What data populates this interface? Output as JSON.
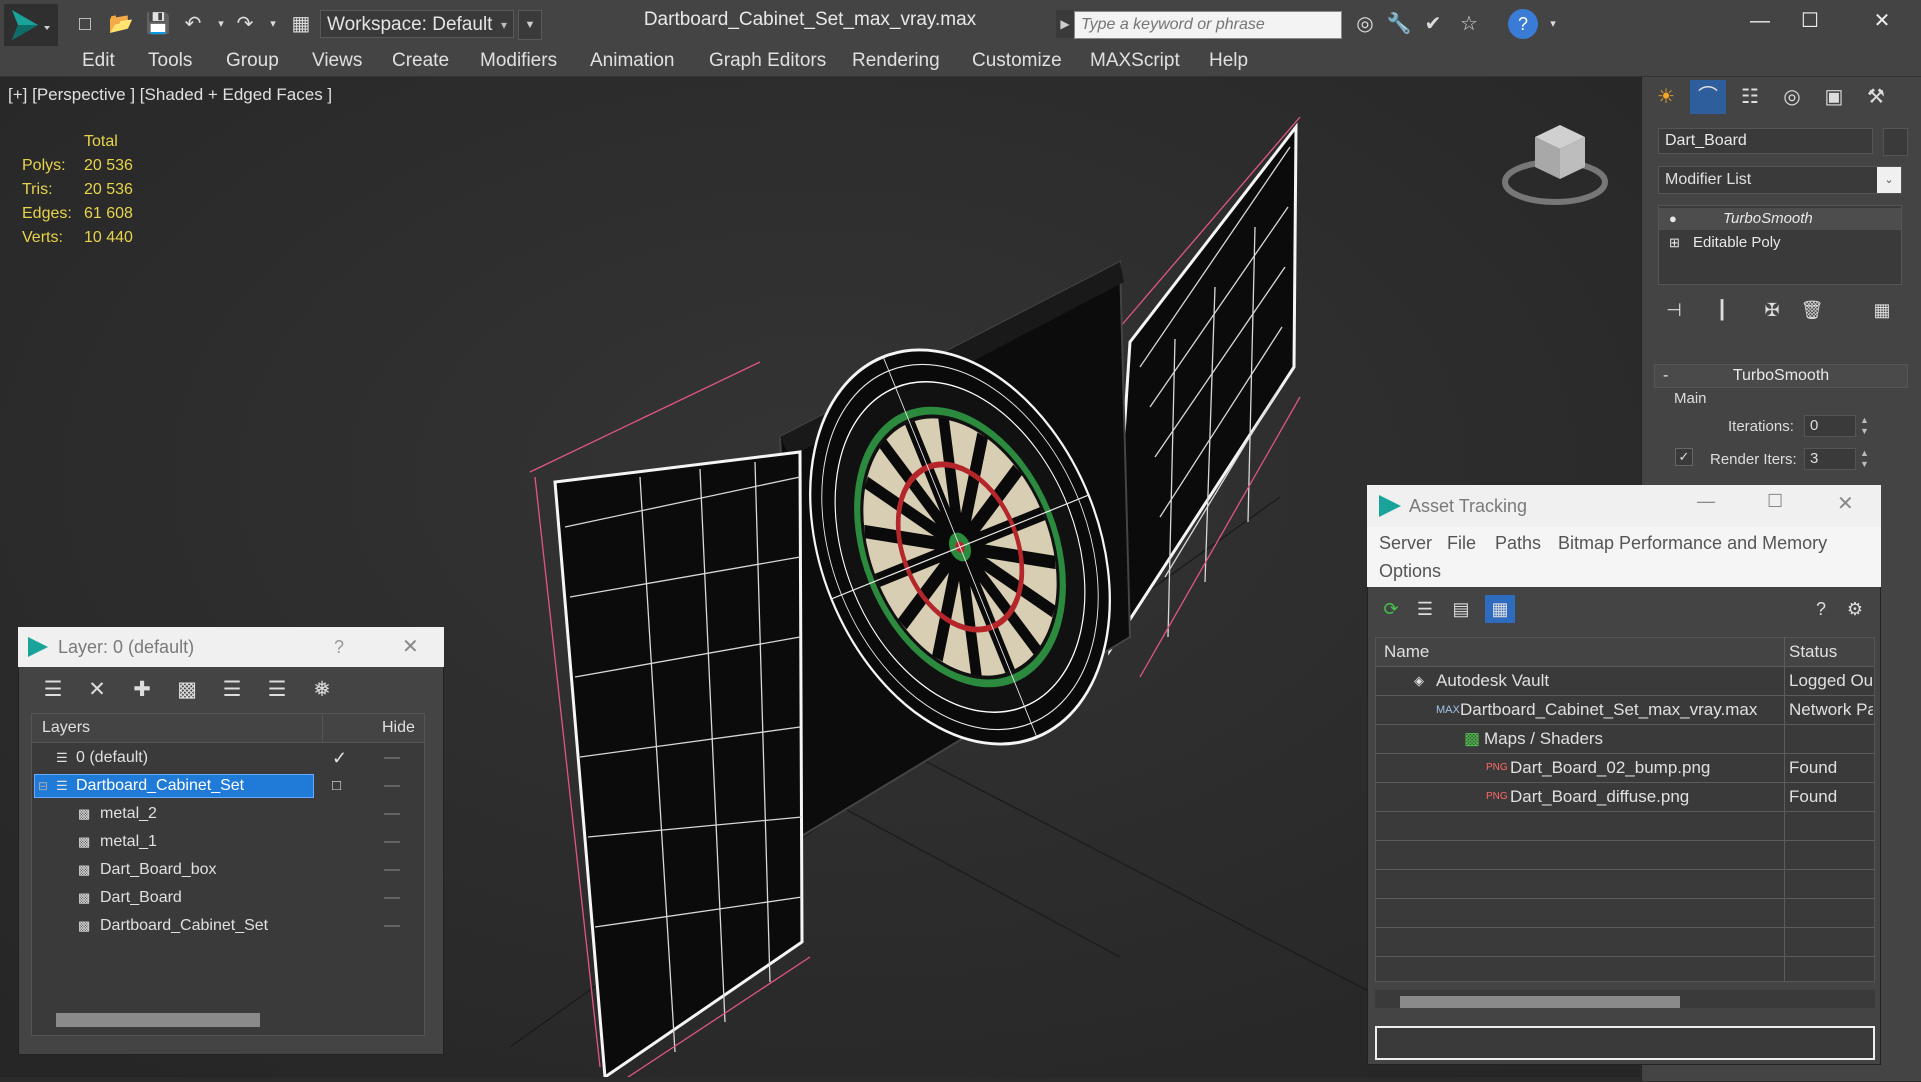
{
  "app": {
    "title": "Dartboard_Cabinet_Set_max_vray.max",
    "workspace_label": "Workspace: Default",
    "search_placeholder": "Type a keyword or phrase"
  },
  "menu": [
    "Edit",
    "Tools",
    "Group",
    "Views",
    "Create",
    "Modifiers",
    "Animation",
    "Graph Editors",
    "Rendering",
    "Customize",
    "MAXScript",
    "Help"
  ],
  "viewport": {
    "label": "[+] [Perspective ] [Shaded + Edged Faces ]",
    "stats": {
      "header": "Total",
      "rows": [
        {
          "key": "Polys:",
          "value": "20 536"
        },
        {
          "key": "Tris:",
          "value": "20 536"
        },
        {
          "key": "Edges:",
          "value": "61 608"
        },
        {
          "key": "Verts:",
          "value": "10 440"
        }
      ]
    }
  },
  "command_panel": {
    "object_name": "Dart_Board",
    "modifier_list": "Modifier List",
    "stack": [
      "TurboSmooth",
      "Editable Poly"
    ],
    "rollout_title": "TurboSmooth",
    "group_main": "Main",
    "iterations_label": "Iterations:",
    "iterations_value": "0",
    "render_iters_label": "Render Iters:",
    "render_iters_value": "3",
    "rollout_toggle": "-"
  },
  "asset_tracking": {
    "title": "Asset Tracking",
    "menu": [
      "Server",
      "File",
      "Paths",
      "Bitmap Performance and Memory",
      "Options"
    ],
    "columns": {
      "name": "Name",
      "status": "Status"
    },
    "rows": [
      {
        "name": "Autodesk Vault",
        "status": "Logged Out"
      },
      {
        "name": "Dartboard_Cabinet_Set_max_vray.max",
        "status": "Network Path"
      },
      {
        "name": "Maps / Shaders",
        "status": ""
      },
      {
        "name": "Dart_Board_02_bump.png",
        "status": "Found"
      },
      {
        "name": "Dart_Board_diffuse.png",
        "status": "Found"
      }
    ]
  },
  "layer_window": {
    "title": "Layer: 0 (default)",
    "help": "?",
    "columns": {
      "layers": "Layers",
      "hide": "Hide"
    },
    "rows": [
      {
        "name": "0 (default)"
      },
      {
        "name": "Dartboard_Cabinet_Set"
      },
      {
        "name": "metal_2"
      },
      {
        "name": "metal_1"
      },
      {
        "name": "Dart_Board_box"
      },
      {
        "name": "Dart_Board"
      },
      {
        "name": "Dartboard_Cabinet_Set"
      }
    ]
  },
  "colors": {
    "accent": "#1f7ad8",
    "stats_yellow": "#e8d44a",
    "selection_pink": "#e0558a",
    "panel_bg": "#444444"
  }
}
